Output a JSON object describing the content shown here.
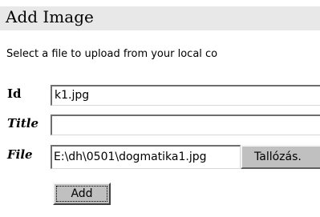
{
  "header": {
    "title": "Add Image"
  },
  "form": {
    "instruction": "Select a file to upload from your local co",
    "id_label": "Id",
    "id_value": "k1.jpg",
    "title_label": "Title",
    "title_value": "",
    "file_label": "File",
    "file_value": "E:\\dh\\0501\\dogmatika1.jpg",
    "browse_label": "Tallózás.",
    "add_label": "Add"
  },
  "colors": {
    "title_bar_background": "#e8e8e8",
    "button_face": "#c0c0c0",
    "page_background": "#ffffff"
  }
}
